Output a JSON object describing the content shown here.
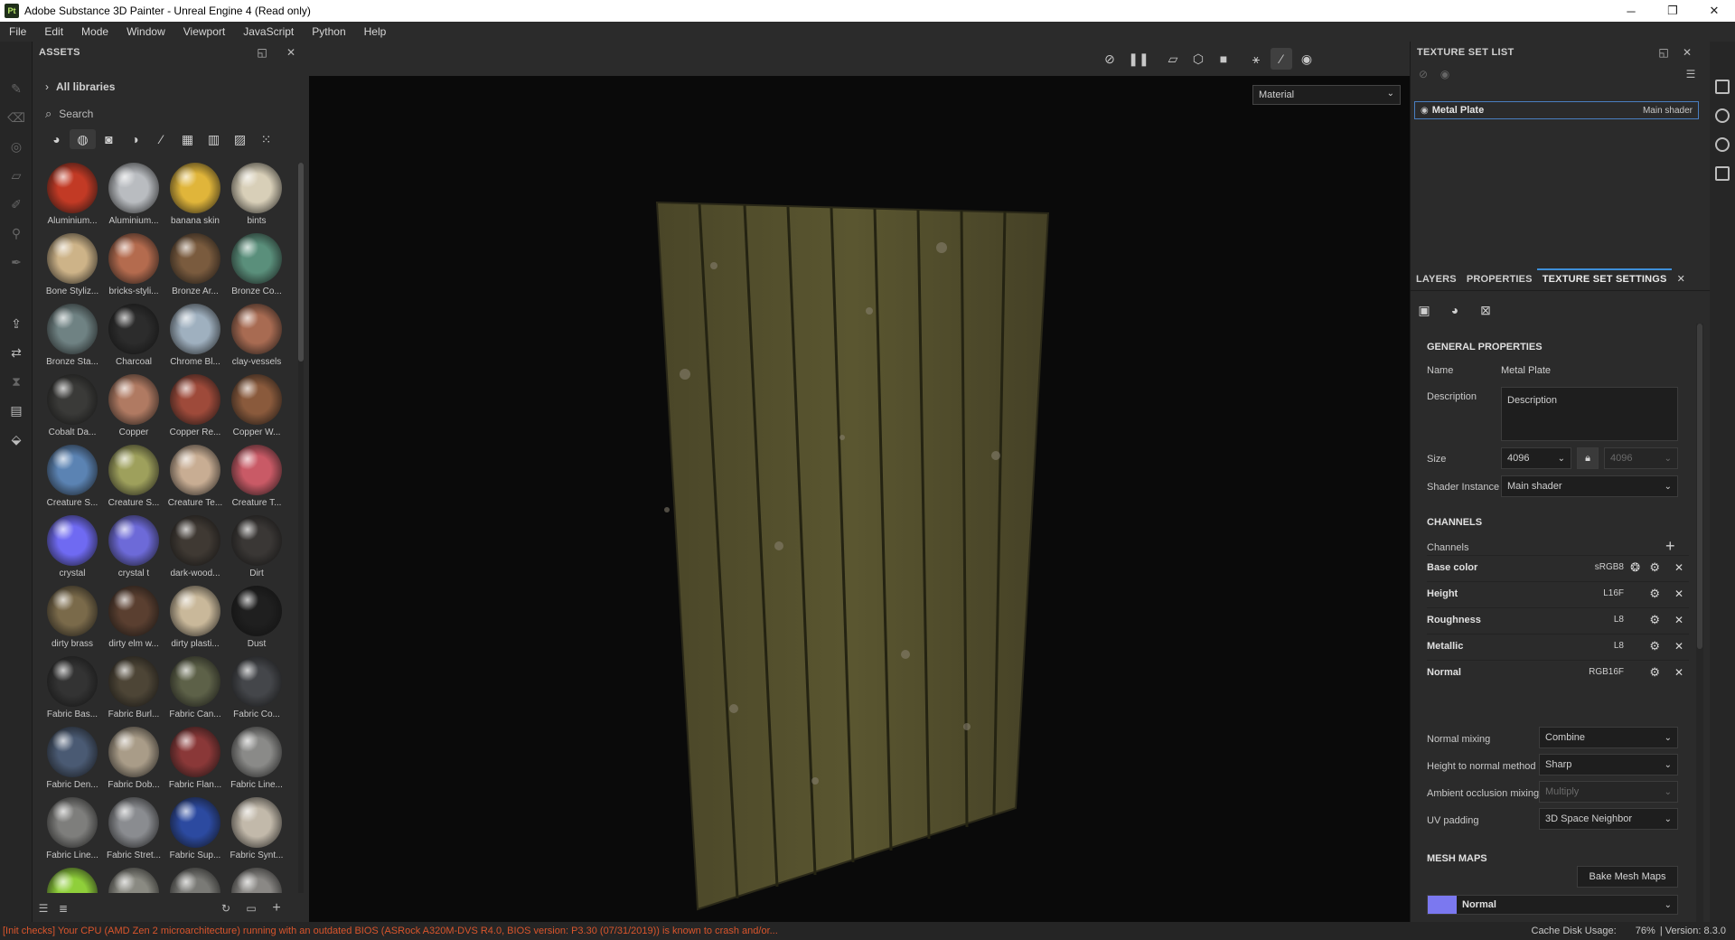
{
  "window": {
    "title": "Adobe Substance 3D Painter - Unreal Engine 4 (Read only)",
    "logo_text": "Pt",
    "minimize_icon": "minimize-icon",
    "maximize_icon": "restore-icon",
    "close_icon": "close-icon"
  },
  "menu": [
    "File",
    "Edit",
    "Mode",
    "Window",
    "Viewport",
    "JavaScript",
    "Python",
    "Help"
  ],
  "assets": {
    "title": "ASSETS",
    "library": "All libraries",
    "search_placeholder": "Search",
    "items": [
      {
        "label": "Aluminium...",
        "color": "#c23a25"
      },
      {
        "label": "Aluminium...",
        "color": "#b9bcc0"
      },
      {
        "label": "banana skin",
        "color": "#e0b53a"
      },
      {
        "label": "bints",
        "color": "#d8cfb8"
      },
      {
        "label": "Bone Styliz...",
        "color": "#cdb388"
      },
      {
        "label": "bricks-styli...",
        "color": "#b46b4e"
      },
      {
        "label": "Bronze Ar...",
        "color": "#7a5b3e"
      },
      {
        "label": "Bronze Co...",
        "color": "#5a8f7b"
      },
      {
        "label": "Bronze Sta...",
        "color": "#6f8283"
      },
      {
        "label": "Charcoal",
        "color": "#2c2c2c"
      },
      {
        "label": "Chrome Bl...",
        "color": "#9fb0bf"
      },
      {
        "label": "clay-vessels",
        "color": "#a86b52"
      },
      {
        "label": "Cobalt Da...",
        "color": "#3a3a38"
      },
      {
        "label": "Copper",
        "color": "#b07a62"
      },
      {
        "label": "Copper Re...",
        "color": "#9e4a3a"
      },
      {
        "label": "Copper W...",
        "color": "#8a5a3c"
      },
      {
        "label": "Creature S...",
        "color": "#5b83b3"
      },
      {
        "label": "Creature S...",
        "color": "#9ea05c"
      },
      {
        "label": "Creature Te...",
        "color": "#c8ad93"
      },
      {
        "label": "Creature T...",
        "color": "#c95a66"
      },
      {
        "label": "crystal",
        "color": "#6f6af2"
      },
      {
        "label": "crystal t",
        "color": "#6d6ad8"
      },
      {
        "label": "dark-wood...",
        "color": "#3f3933"
      },
      {
        "label": "Dirt",
        "color": "#3a3735"
      },
      {
        "label": "dirty brass",
        "color": "#7a6a4a"
      },
      {
        "label": "dirty elm w...",
        "color": "#5a3f30"
      },
      {
        "label": "dirty plasti...",
        "color": "#c9b89a"
      },
      {
        "label": "Dust",
        "color": "#1f1f1f"
      },
      {
        "label": "Fabric Bas...",
        "color": "#333333"
      },
      {
        "label": "Fabric Burl...",
        "color": "#4d4536"
      },
      {
        "label": "Fabric Can...",
        "color": "#5d6148"
      },
      {
        "label": "Fabric Co...",
        "color": "#44464a"
      },
      {
        "label": "Fabric Den...",
        "color": "#4a5a73"
      },
      {
        "label": "Fabric Dob...",
        "color": "#a99c88"
      },
      {
        "label": "Fabric Flan...",
        "color": "#8a3838"
      },
      {
        "label": "Fabric Line...",
        "color": "#8a8a88"
      },
      {
        "label": "Fabric Line...",
        "color": "#7e7e7c"
      },
      {
        "label": "Fabric Stret...",
        "color": "#8a8c90"
      },
      {
        "label": "Fabric Sup...",
        "color": "#2c4aa0"
      },
      {
        "label": "Fabric Synt...",
        "color": "#c2b9aa"
      },
      {
        "label": "",
        "color": "#8fcf3a"
      },
      {
        "label": "",
        "color": "#8a8a82"
      },
      {
        "label": "",
        "color": "#7a7a76"
      },
      {
        "label": "",
        "color": "#8a8885"
      }
    ]
  },
  "viewport": {
    "mode_select": "Material"
  },
  "texture_set_list": {
    "title": "TEXTURE SET LIST",
    "item_name": "Metal Plate",
    "item_shader": "Main shader"
  },
  "tabs": [
    "LAYERS",
    "PROPERTIES",
    "TEXTURE SET SETTINGS"
  ],
  "ts_settings": {
    "general_title": "GENERAL PROPERTIES",
    "name_label": "Name",
    "name_value": "Metal Plate",
    "desc_label": "Description",
    "desc_value": "Description",
    "size_label": "Size",
    "size_value": "4096",
    "size_value2": "4096",
    "shader_label": "Shader Instance",
    "shader_value": "Main shader",
    "channels_title": "CHANNELS",
    "channels_label": "Channels",
    "channels": [
      {
        "name": "Base color",
        "format": "sRGB8"
      },
      {
        "name": "Height",
        "format": "L16F"
      },
      {
        "name": "Roughness",
        "format": "L8"
      },
      {
        "name": "Metallic",
        "format": "L8"
      },
      {
        "name": "Normal",
        "format": "RGB16F"
      }
    ],
    "normal_mixing_label": "Normal mixing",
    "normal_mixing_value": "Combine",
    "height_normal_label": "Height to normal method",
    "height_normal_value": "Sharp",
    "ao_mixing_label": "Ambient occlusion mixing",
    "ao_mixing_value": "Multiply",
    "uv_padding_label": "UV padding",
    "uv_padding_value": "3D Space Neighbor",
    "mesh_maps_title": "MESH MAPS",
    "bake_button": "Bake Mesh Maps",
    "mesh_map_first": "Normal",
    "mesh_map_color": "#7b78f0"
  },
  "status": {
    "message": "[Init checks] Your CPU (AMD Zen 2 microarchitecture) running with an outdated BIOS (ASRock A320M-DVS R4.0, BIOS version: P3.30 (07/31/2019)) is known to crash and/or...",
    "cache_label": "Cache Disk Usage:",
    "cache_value": "76%",
    "version": "| Version: 8.3.0"
  }
}
